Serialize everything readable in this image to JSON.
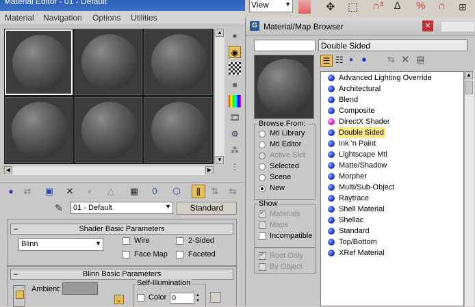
{
  "material_editor": {
    "title": "Material Editor - 01 - Default",
    "menu": [
      "Material",
      "Navigation",
      "Options",
      "Utilities"
    ],
    "material_name": "01 - Default",
    "material_type_button": "Standard",
    "shader_rollout": {
      "title": "Shader Basic Parameters",
      "shader": "Blinn",
      "wire": "Wire",
      "two_sided": "2-Sided",
      "face_map": "Face Map",
      "faceted": "Faceted"
    },
    "blinn_rollout": {
      "title": "Blinn Basic Parameters",
      "self_illum_label": "Self-Illumination",
      "color_label": "Color",
      "color_value": "0",
      "ambient_label": "Ambient:"
    }
  },
  "top_strip": {
    "view_label": "View"
  },
  "browser": {
    "title": "Material/Map Browser",
    "search_value": "",
    "current_name": "Double Sided",
    "browse_from": {
      "title": "Browse From:",
      "options": [
        "Mtl Library",
        "Mtl Editor",
        "Active Slot",
        "Selected",
        "Scene",
        "New"
      ],
      "selected": "New"
    },
    "show": {
      "title": "Show",
      "materials": "Materials",
      "maps": "Maps",
      "incompatible": "Incompatible",
      "root_only": "Root Only",
      "by_object": "By Object"
    },
    "items": [
      "Advanced Lighting Override",
      "Architectural",
      "Blend",
      "Composite",
      "DirectX Shader",
      "Double Sided",
      "Ink 'n Paint",
      "Lightscape Mtl",
      "Matte/Shadow",
      "Morpher",
      "Multi/Sub-Object",
      "Raytrace",
      "Shell Material",
      "Shellac",
      "Standard",
      "Top/Bottom",
      "XRef Material"
    ],
    "highlighted_item": "Double Sided",
    "colors": {
      "item_highlight": "#ffe88a",
      "material_dot": "#1f3ed0",
      "directx_dot": "#d02bc0"
    }
  }
}
